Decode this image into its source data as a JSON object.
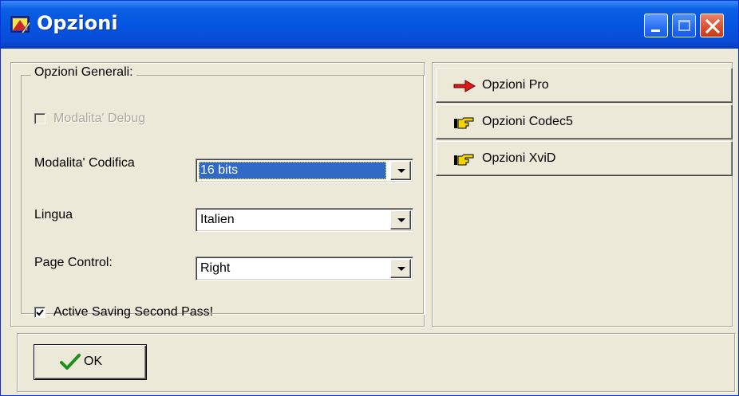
{
  "window": {
    "title": "Opzioni",
    "accent_color": "#0454e0",
    "controls": {
      "minimize": "minimize-icon",
      "maximize": "maximize-icon",
      "close": "close-icon"
    }
  },
  "general": {
    "group_title": "Opzioni Generali:",
    "debug": {
      "label": "Modalita' Debug",
      "checked": false,
      "enabled": false
    },
    "encoding": {
      "label": "Modalita' Codifica",
      "value": "16 bits"
    },
    "language": {
      "label": "Lingua",
      "value": "Italien"
    },
    "page_control": {
      "label": "Page Control:",
      "value": "Right"
    },
    "active_saving": {
      "label": "Active Saving Second Pass!",
      "checked": true
    }
  },
  "options": [
    {
      "label": "Opzioni Pro",
      "icon": "red-arrow-icon"
    },
    {
      "label": "Opzioni Codec5",
      "icon": "pointing-hand-icon"
    },
    {
      "label": "Opzioni XviD",
      "icon": "pointing-hand-icon"
    }
  ],
  "footer": {
    "ok_label": "OK",
    "ok_icon": "green-check-icon"
  }
}
